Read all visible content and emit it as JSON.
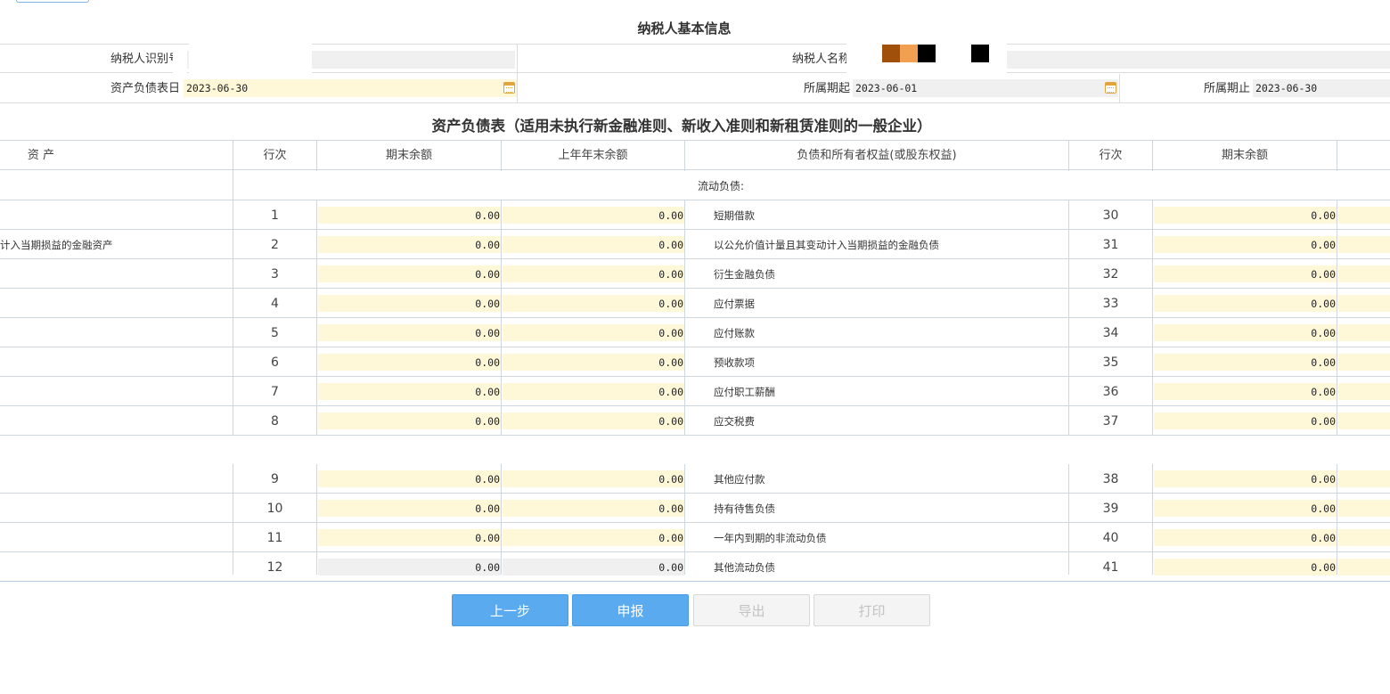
{
  "info": {
    "title": "纳税人基本信息",
    "taxpayer_id_label": "纳税人识别号",
    "taxpayer_name_label": "纳税人名称",
    "balance_date_label": "资产负债表日",
    "balance_date_value": "2023-06-30",
    "period_start_label": "所属期起",
    "period_start_value": "2023-06-01",
    "period_end_label": "所属期止",
    "period_end_value": "2023-06-30"
  },
  "sheet": {
    "title": "资产负债表（适用未执行新金融准则、新收入准则和新租赁准则的一般企业）",
    "headers": {
      "asset": "资 产",
      "line1": "行次",
      "end_balance1": "期末余额",
      "prev_balance1": "上年年末余额",
      "liability": "负债和所有者权益(或股东权益)",
      "line2": "行次",
      "end_balance2": "期末余额"
    },
    "section_current_liabilities": "流动负债:",
    "rows": [
      {
        "asset": "",
        "n1": "1",
        "end": "0.00",
        "prev": "0.00",
        "liab": "短期借款",
        "n2": "30",
        "end2": "0.00"
      },
      {
        "asset": "计入当期损益的金融资产",
        "n1": "2",
        "end": "0.00",
        "prev": "0.00",
        "liab": "以公允价值计量且其变动计入当期损益的金融负债",
        "n2": "31",
        "end2": "0.00"
      },
      {
        "asset": "",
        "n1": "3",
        "end": "0.00",
        "prev": "0.00",
        "liab": "衍生金融负债",
        "n2": "32",
        "end2": "0.00"
      },
      {
        "asset": "",
        "n1": "4",
        "end": "0.00",
        "prev": "0.00",
        "liab": "应付票据",
        "n2": "33",
        "end2": "0.00"
      },
      {
        "asset": "",
        "n1": "5",
        "end": "0.00",
        "prev": "0.00",
        "liab": "应付账款",
        "n2": "34",
        "end2": "0.00"
      },
      {
        "asset": "",
        "n1": "6",
        "end": "0.00",
        "prev": "0.00",
        "liab": "预收款项",
        "n2": "35",
        "end2": "0.00"
      },
      {
        "asset": "",
        "n1": "7",
        "end": "0.00",
        "prev": "0.00",
        "liab": "应付职工薪酬",
        "n2": "36",
        "end2": "0.00"
      },
      {
        "asset": "",
        "n1": "8",
        "end": "0.00",
        "prev": "0.00",
        "liab": "应交税费",
        "n2": "37",
        "end2": "0.00"
      },
      {
        "asset": "",
        "n1": "9",
        "end": "0.00",
        "prev": "0.00",
        "liab": "其他应付款",
        "n2": "38",
        "end2": "0.00"
      },
      {
        "asset": "",
        "n1": "10",
        "end": "0.00",
        "prev": "0.00",
        "liab": "持有待售负债",
        "n2": "39",
        "end2": "0.00"
      },
      {
        "asset": "",
        "n1": "11",
        "end": "0.00",
        "prev": "0.00",
        "liab": "一年内到期的非流动负债",
        "n2": "40",
        "end2": "0.00"
      },
      {
        "asset": "",
        "n1": "12",
        "end": "0.00",
        "prev": "0.00",
        "liab": "其他流动负债",
        "n2": "41",
        "end2": "0.00"
      }
    ]
  },
  "buttons": {
    "prev": "上一步",
    "submit": "申报",
    "export": "导出",
    "print": "打印"
  },
  "colors": {
    "primary": "#5aaaf0",
    "input_bg": "#fff8d8",
    "readonly_bg": "#f0f0f0",
    "calendar_icon": "#e2a43c"
  }
}
